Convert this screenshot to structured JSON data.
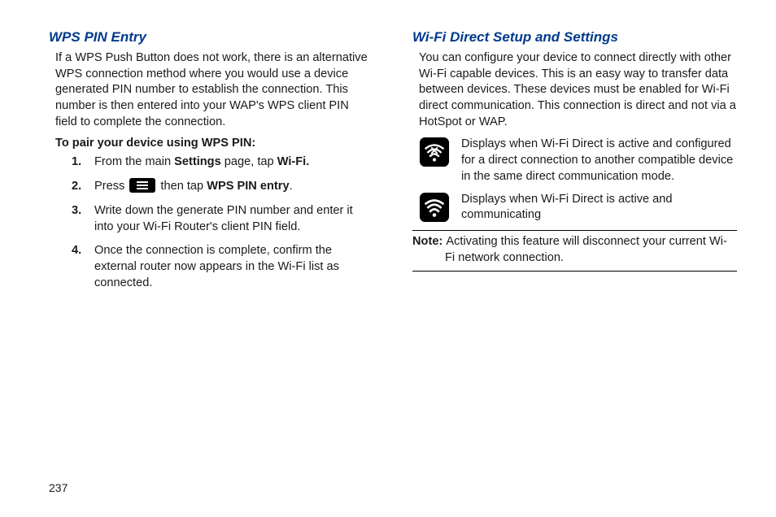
{
  "left": {
    "heading": "WPS PIN Entry",
    "intro": "If a WPS Push Button does not work, there is an alternative WPS connection method where you would use a device generated PIN number to establish the connection. This number is then entered into your WAP's WPS client PIN field to complete the connection.",
    "subheading": "To pair your device using WPS PIN:",
    "step1_num": "1.",
    "step1_a": "From the main ",
    "step1_b": "Settings",
    "step1_c": " page, tap ",
    "step1_d": "Wi-Fi.",
    "step2_num": "2.",
    "step2_a": "Press ",
    "step2_b": " then tap ",
    "step2_c": "WPS PIN entry",
    "step2_d": ".",
    "step3_num": "3.",
    "step3": "Write down the generate PIN number and enter it into your Wi-Fi Router's client PIN field.",
    "step4_num": "4.",
    "step4": "Once the connection is complete, confirm the external router now appears in the Wi-Fi list as connected."
  },
  "right": {
    "heading": "Wi-Fi Direct Setup and Settings",
    "intro": "You can configure your device to connect directly with other Wi-Fi capable devices. This is an easy way to transfer data between devices. These devices must be enabled for Wi-Fi direct communication. This connection is direct and not via a HotSpot or WAP.",
    "icon1_desc": "Displays when Wi-Fi Direct is active and configured for a direct connection to another compatible device in the same direct communication mode.",
    "icon2_desc": "Displays when Wi-Fi Direct is active and communicating",
    "note_label": "Note: ",
    "note_text": "Activating this feature will disconnect your current Wi-Fi network connection."
  },
  "page_number": "237"
}
